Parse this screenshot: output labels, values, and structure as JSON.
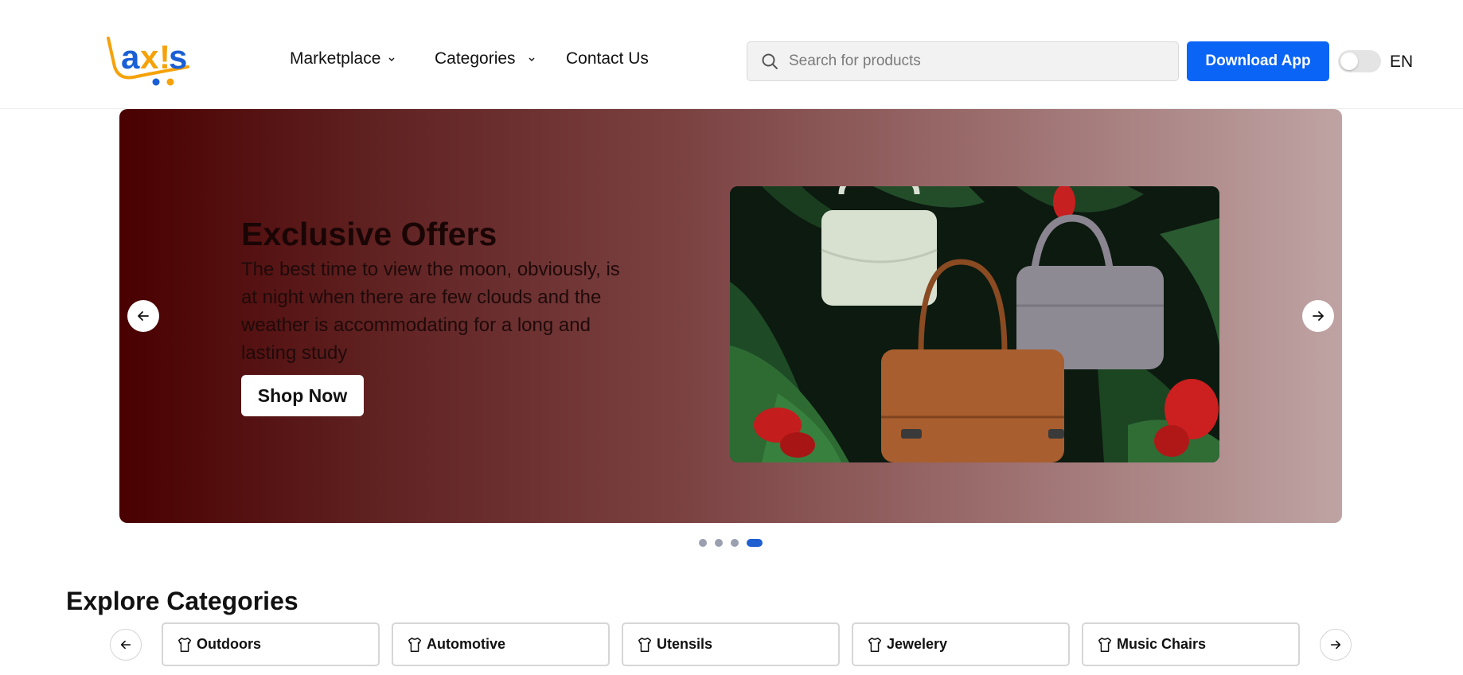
{
  "header": {
    "logo_text": "axis",
    "nav": [
      {
        "label": "Marketplace",
        "has_dropdown": true
      },
      {
        "label": "Categories",
        "has_dropdown": true
      },
      {
        "label": "Contact Us",
        "has_dropdown": false
      }
    ],
    "search": {
      "placeholder": "Search for products",
      "value": "",
      "icon": "search-icon"
    },
    "download_label": "Download App",
    "theme_toggle": {
      "on": false
    },
    "language": "EN"
  },
  "banner": {
    "title": "Exclusive Offers",
    "description": "The best time to view the moon, obviously, is at night when there are few clouds and the weather is accommodating for a long and lasting study",
    "cta_label": "Shop Now",
    "slides_count": 4,
    "active_slide": 4
  },
  "categories": {
    "title": "Explore Categories",
    "items": [
      {
        "label": "Outdoors",
        "icon": "shirt-icon"
      },
      {
        "label": "Automotive",
        "icon": "shirt-icon"
      },
      {
        "label": "Utensils",
        "icon": "shirt-icon"
      },
      {
        "label": "Jewelery",
        "icon": "shirt-icon"
      },
      {
        "label": "Music Chairs",
        "icon": "shirt-icon"
      }
    ]
  },
  "colors": {
    "primary": "#0a64f5",
    "logo_orange": "#f5a20a",
    "logo_blue": "#1a5fd6",
    "banner_dark": "#4a0000",
    "banner_light": "#bfa3a3"
  }
}
